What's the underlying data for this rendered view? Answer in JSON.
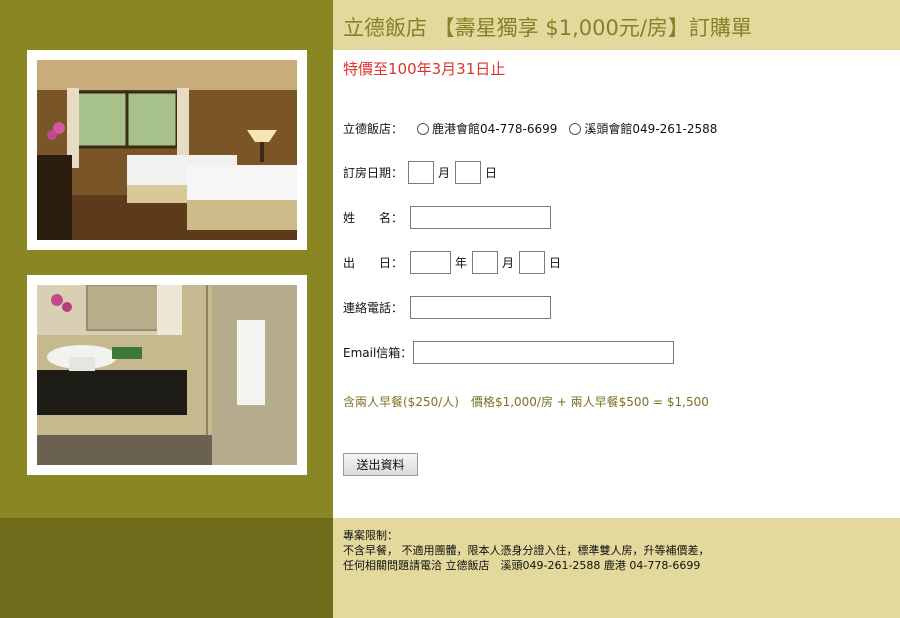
{
  "header": {
    "title": "立德飯店 【壽星獨享 $1,000元/房】訂購單"
  },
  "promo": {
    "note": "特價至100年3月31日止"
  },
  "form": {
    "hotel_label": "立德飯店：",
    "hotel_options": [
      {
        "label": "鹿港會館04-778-6699"
      },
      {
        "label": "溪頭會館049-261-2588"
      }
    ],
    "booking_date_label": "訂房日期：",
    "month_unit": "月",
    "day_unit": "日",
    "name_label": "姓　　名：",
    "birthday_label": "出　　日：",
    "year_unit": "年",
    "phone_label": "連絡電話：",
    "email_label": "Email信箱："
  },
  "pricing": {
    "text": "含兩人早餐($250/人)　價格$1,000/房 + 兩人早餐$500 = $1,500"
  },
  "submit_label": "送出資料",
  "footer": {
    "line1": "專案限制：",
    "line2": "不含早餐， 不適用團體，限本人憑身分證入住，標準雙人房，升等補價差，",
    "line3": "任何相關問題請電洽 立德飯店　溪頭049-261-2588 鹿港 04-778-6699"
  },
  "colors": {
    "left_panel": "#8a8624",
    "header_bg": "#e4d99c",
    "title": "#86802a",
    "promo": "#e0312a",
    "price": "#7d7224"
  }
}
